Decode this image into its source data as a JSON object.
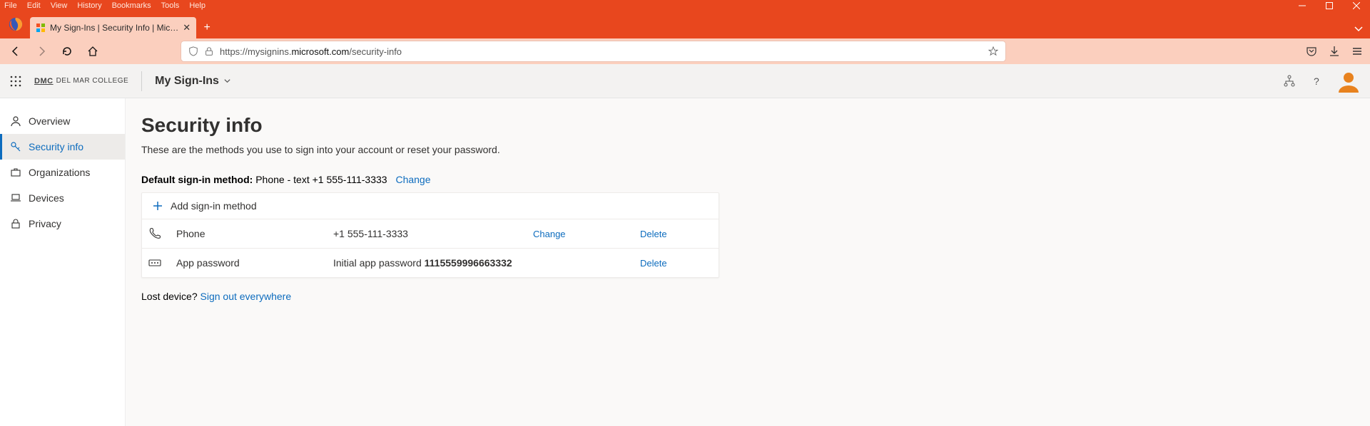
{
  "browser": {
    "menu": {
      "file": "File",
      "edit": "Edit",
      "view": "View",
      "history": "History",
      "bookmarks": "Bookmarks",
      "tools": "Tools",
      "help": "Help"
    },
    "tab_title": "My Sign-Ins | Security Info | Mic…",
    "url_prefix": "https://mysignins.",
    "url_host": "microsoft.com",
    "url_path": "/security-info"
  },
  "header": {
    "brand_text": "DEL MAR COLLEGE",
    "brand_short": "DMC",
    "app_name": "My Sign-Ins"
  },
  "sidebar": {
    "items": [
      {
        "label": "Overview"
      },
      {
        "label": "Security info"
      },
      {
        "label": "Organizations"
      },
      {
        "label": "Devices"
      },
      {
        "label": "Privacy"
      }
    ]
  },
  "page": {
    "title": "Security info",
    "subtitle": "These are the methods you use to sign into your account or reset your password.",
    "default_label": "Default sign-in method:",
    "default_value": "Phone - text +1 555-111-3333",
    "change_label": "Change",
    "add_label": "Add sign-in method",
    "lost_text": "Lost device?",
    "signout_text": "Sign out everywhere"
  },
  "methods": [
    {
      "name": "Phone",
      "value": "+1  555-111-3333",
      "change": "Change",
      "delete": "Delete"
    },
    {
      "name": "App password",
      "value_prefix": "Initial app password ",
      "value_bold": "1115559996663332",
      "delete": "Delete"
    }
  ]
}
